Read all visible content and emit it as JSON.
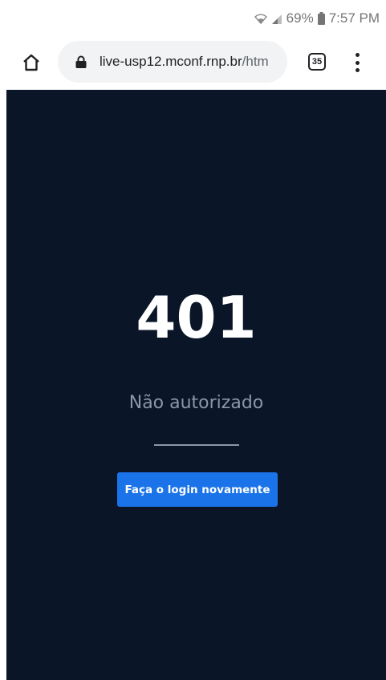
{
  "status_bar": {
    "battery": "69%",
    "time": "7:57 PM",
    "icons": [
      "wifi-icon",
      "signal-icon",
      "battery-icon"
    ]
  },
  "browser": {
    "url_domain": "live-usp12.mconf.rnp.br",
    "url_path": "/htm",
    "tab_count": "35",
    "icons": [
      "home-icon",
      "lock-icon",
      "tabs-icon",
      "more-vert-icon"
    ]
  },
  "page": {
    "error_code": "401",
    "error_message": "Não autorizado",
    "button_label": "Faça o login novamente"
  },
  "colors": {
    "background": "#0a1628",
    "button": "#1a73e8",
    "muted_text": "#8b97a6"
  }
}
